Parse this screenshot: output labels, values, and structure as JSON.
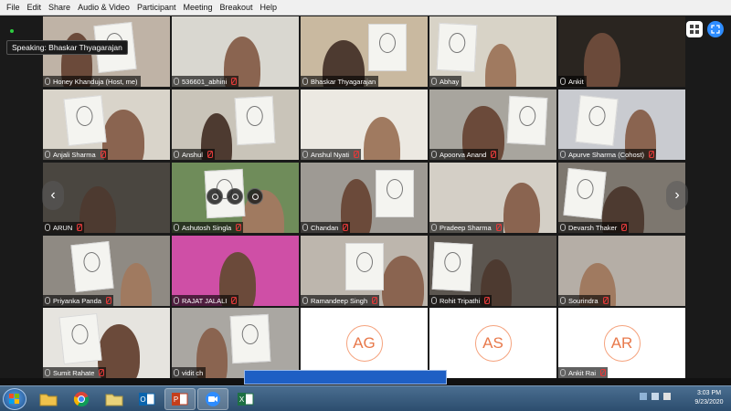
{
  "menu": [
    "File",
    "Edit",
    "Share",
    "Audio & Video",
    "Participant",
    "Meeting",
    "Breakout",
    "Help"
  ],
  "speaking": "Speaking: Bhaskar Thyagarajan",
  "tiles": [
    {
      "name": "Honey Khanduja (Host, me)",
      "muted": false,
      "bg": "#bfb3a6"
    },
    {
      "name": "536601_abhini",
      "muted": true,
      "bg": "#d9d7d0"
    },
    {
      "name": "Bhaskar Thyagarajan",
      "muted": false,
      "bg": "#c9b9a0",
      "active": true
    },
    {
      "name": "Abhay",
      "muted": false,
      "bg": "#d8d3c7"
    },
    {
      "name": "Ankit",
      "muted": false,
      "bg": "#2a2520"
    },
    {
      "name": "Anjali Sharma",
      "muted": true,
      "bg": "#d9d4ca"
    },
    {
      "name": "Anshul",
      "muted": true,
      "bg": "#c9c4b9"
    },
    {
      "name": "Anshul Nyati",
      "muted": true,
      "bg": "#ece9e2"
    },
    {
      "name": "Apoorva Anand",
      "muted": true,
      "bg": "#a8a59e"
    },
    {
      "name": "Apurve Sharma (Cohost)",
      "muted": true,
      "bg": "#c9cbd0"
    },
    {
      "name": "ARUN",
      "muted": true,
      "bg": "#4a4640"
    },
    {
      "name": "Ashutosh Singla",
      "muted": true,
      "bg": "#6f8c5a"
    },
    {
      "name": "Chandan",
      "muted": true,
      "bg": "#9e9a94"
    },
    {
      "name": "Pradeep Sharma",
      "muted": true,
      "bg": "#d4cfc6"
    },
    {
      "name": "Devarsh Thaker",
      "muted": true,
      "bg": "#7d776f"
    },
    {
      "name": "Priyanka Panda",
      "muted": true,
      "bg": "#8f8a83"
    },
    {
      "name": "RAJAT JALALI",
      "muted": true,
      "bg": "#cf4fa6"
    },
    {
      "name": "Ramandeep Singh",
      "muted": true,
      "bg": "#bdb6ad"
    },
    {
      "name": "Rohit Tripathi",
      "muted": true,
      "bg": "#5c5650"
    },
    {
      "name": "Sourindra",
      "muted": true,
      "bg": "#b5aea6"
    },
    {
      "name": "Sumit Rahate",
      "muted": true,
      "bg": "#e6e4df"
    },
    {
      "name": "vidit ch",
      "muted": false,
      "bg": "#aaa7a2"
    },
    {
      "name": "",
      "muted": false,
      "avatar": "AG"
    },
    {
      "name": "",
      "muted": false,
      "avatar": "AS"
    },
    {
      "name": "Ankit Rai",
      "muted": true,
      "avatar": "AR"
    }
  ],
  "taskbar": {
    "apps": [
      "file-explorer",
      "chrome",
      "folder",
      "outlook",
      "powerpoint",
      "zoom",
      "excel"
    ],
    "time": "3:03 PM",
    "date": "9/23/2020"
  },
  "colors": {
    "accent": "#2d8cff",
    "avatar_ring": "#f5a37e",
    "avatar_text": "#e8794b",
    "muted": "#e03a3a"
  }
}
